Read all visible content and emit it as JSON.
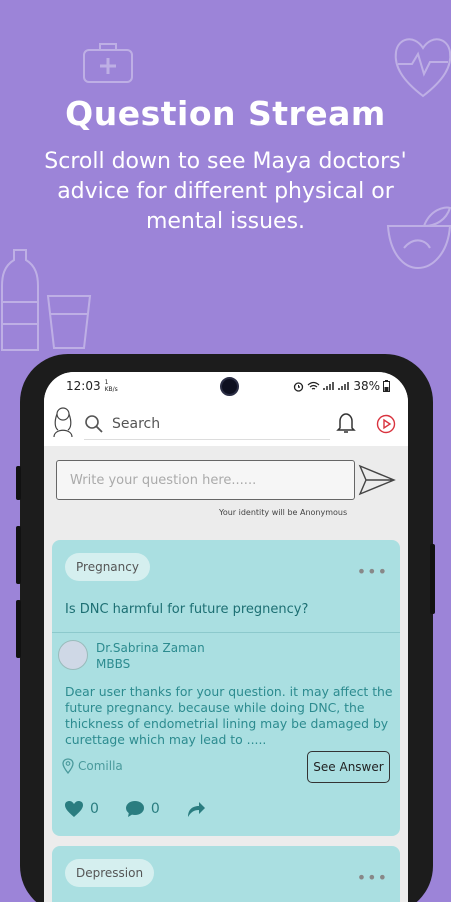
{
  "header": {
    "title": "Question Stream",
    "subtitle": "Scroll down to see Maya doctors' advice for different physical or mental issues."
  },
  "statusbar": {
    "time": "12:03",
    "data_rate": "1 KB/s",
    "battery": "38%"
  },
  "appbar": {
    "search_placeholder": "Search"
  },
  "ask": {
    "placeholder": "Write your question here......",
    "anonymous_note": "Your identity will be Anonymous"
  },
  "posts": [
    {
      "tag": "Pregnancy",
      "question": "Is DNC harmful for future pregnency?",
      "doctor_name": "Dr.Sabrina Zaman",
      "doctor_degree": "MBBS",
      "answer": "Dear user thanks for your question. it may affect the future pregnancy. because while doing DNC, the thickness of endometrial lining may be damaged by curettage which may lead to .....",
      "location": "Comilla",
      "see_answer_label": "See Answer",
      "likes": "0",
      "comments": "0"
    },
    {
      "tag": "Depression"
    }
  ],
  "colors": {
    "background": "#9c84d8",
    "card": "#aadfe1",
    "accent_red": "#d9343f",
    "text_teal": "#2c8b8f"
  }
}
